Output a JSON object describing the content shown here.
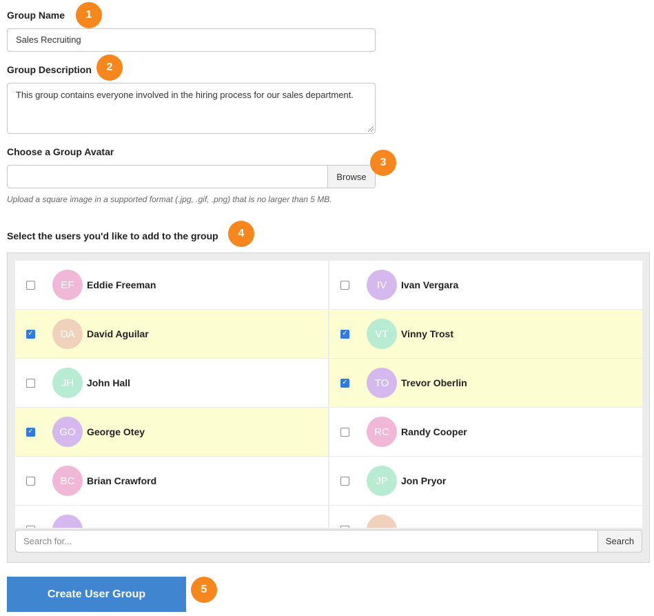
{
  "form": {
    "group_name_label": "Group Name",
    "group_name_value": "Sales Recruiting",
    "group_description_label": "Group Description",
    "group_description_value": "This group contains everyone involved in the hiring process for our sales department.",
    "avatar_label": "Choose a Group Avatar",
    "avatar_file_value": "",
    "browse_label": "Browse",
    "avatar_help": "Upload a square image in a supported format (.jpg, .gif, .png) that is no larger than 5 MB.",
    "users_label": "Select the users you'd like to add to the group",
    "search_placeholder": "Search for...",
    "search_button_label": "Search",
    "create_button_label": "Create User Group"
  },
  "badges": [
    "1",
    "2",
    "3",
    "4",
    "5"
  ],
  "users": [
    {
      "initials": "EF",
      "name": "Eddie Freeman",
      "checked": false,
      "color": "#f0b8d6"
    },
    {
      "initials": "IV",
      "name": "Ivan Vergara",
      "checked": false,
      "color": "#d4b8ee"
    },
    {
      "initials": "DA",
      "name": "David Aguilar",
      "checked": true,
      "color": "#f0d2bc"
    },
    {
      "initials": "VT",
      "name": "Vinny Trost",
      "checked": true,
      "color": "#b8ecd2"
    },
    {
      "initials": "JH",
      "name": "John Hall",
      "checked": false,
      "color": "#b8ecd2"
    },
    {
      "initials": "TO",
      "name": "Trevor Oberlin",
      "checked": true,
      "color": "#d4b8ee"
    },
    {
      "initials": "GO",
      "name": "George Otey",
      "checked": true,
      "color": "#d4b8ee"
    },
    {
      "initials": "RC",
      "name": "Randy Cooper",
      "checked": false,
      "color": "#f0b8d6"
    },
    {
      "initials": "BC",
      "name": "Brian Crawford",
      "checked": false,
      "color": "#f0b8d6"
    },
    {
      "initials": "JP",
      "name": "Jon Pryor",
      "checked": false,
      "color": "#b8ecd2"
    },
    {
      "initials": "",
      "name": "",
      "checked": false,
      "color": "#d4b8ee"
    },
    {
      "initials": "",
      "name": "",
      "checked": false,
      "color": "#f0d2bc"
    }
  ]
}
